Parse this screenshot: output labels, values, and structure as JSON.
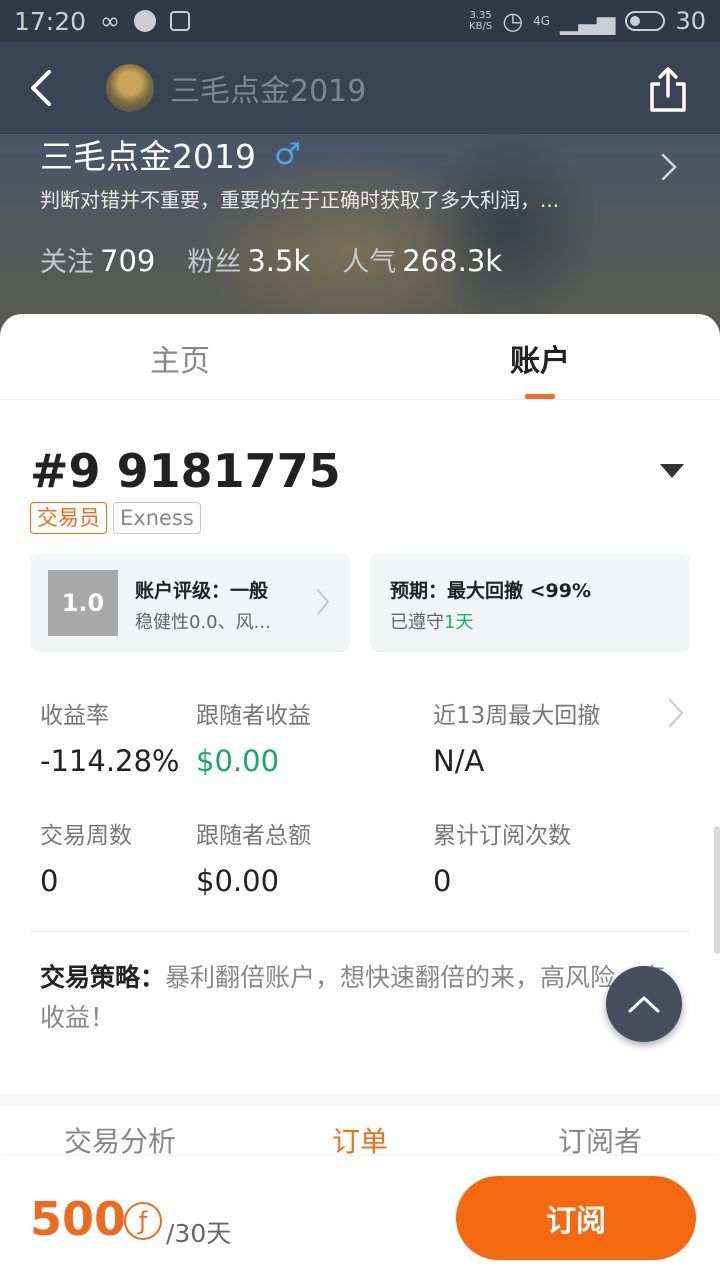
{
  "status_bar": {
    "time": "17:20",
    "net_speed_value": "3.35",
    "net_speed_unit": "KB/S",
    "network": "4G",
    "battery": "30"
  },
  "navbar": {
    "title": "三毛点金2019"
  },
  "profile": {
    "name": "三毛点金2019",
    "gender_symbol": "♂",
    "bio": "判断对错并不重要，重要的在于正确时获取了多大利润，...",
    "stats": [
      {
        "label": "关注",
        "value": "709"
      },
      {
        "label": "粉丝",
        "value": "3.5k"
      },
      {
        "label": "人气",
        "value": "268.3k"
      }
    ]
  },
  "tabs": {
    "home": "主页",
    "account": "账户"
  },
  "account": {
    "number": "#9 9181775",
    "tags": [
      "交易员",
      "Exness"
    ],
    "rating": {
      "score": "1.0",
      "title": "账户评级：一般",
      "subtitle": "稳健性0.0、风..."
    },
    "expectation": {
      "title": "预期：最大回撤 <99%",
      "kept_prefix": "已遵守",
      "kept_days": "1天"
    },
    "metrics": [
      {
        "label": "收益率",
        "value": "-114.28%"
      },
      {
        "label": "跟随者收益",
        "value": "$0.00"
      },
      {
        "label": "近13周最大回撤",
        "value": "N/A"
      },
      {
        "label": "交易周数",
        "value": "0"
      },
      {
        "label": "跟随者总额",
        "value": "$0.00"
      },
      {
        "label": "累计订阅次数",
        "value": "0"
      }
    ],
    "strategy_label": "交易策略：",
    "strategy_text": "暴利翻倍账户，想快速翻倍的来，高风险，高收益！"
  },
  "subtabs": [
    "交易分析",
    "订单",
    "订阅者"
  ],
  "bottom": {
    "price": "500",
    "coin_symbol": "ƒ",
    "unit": "/30天",
    "subscribe": "订阅"
  },
  "colors": {
    "accent": "#f07020",
    "gain": "#18a868"
  }
}
